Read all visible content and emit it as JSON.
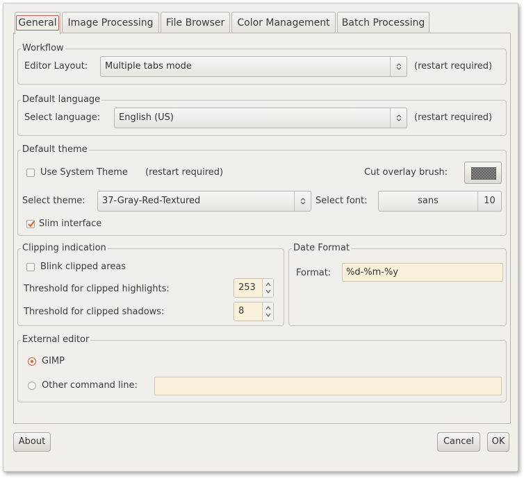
{
  "tabs": [
    {
      "label": "General",
      "active": true
    },
    {
      "label": "Image Processing"
    },
    {
      "label": "File Browser"
    },
    {
      "label": "Color Management"
    },
    {
      "label": "Batch Processing"
    }
  ],
  "workflow": {
    "title": "Workflow",
    "editor_layout_label": "Editor Layout:",
    "editor_layout_value": "Multiple tabs mode",
    "restart_note": "(restart required)"
  },
  "language": {
    "title": "Default language",
    "select_label": "Select language:",
    "select_value": "English (US)",
    "restart_note": "(restart required)"
  },
  "theme": {
    "title": "Default theme",
    "use_system_label": "Use System Theme",
    "use_system_checked": false,
    "use_system_note": "(restart required)",
    "cut_overlay_label": "Cut overlay brush:",
    "select_theme_label": "Select theme:",
    "select_theme_value": "37-Gray-Red-Textured",
    "select_font_label": "Select font:",
    "font_name": "sans",
    "font_size": "10",
    "slim_label": "Slim interface",
    "slim_checked": true
  },
  "clipping": {
    "title": "Clipping indication",
    "blink_label": "Blink clipped areas",
    "blink_checked": false,
    "highlights_label": "Threshold for clipped highlights:",
    "highlights_value": "253",
    "shadows_label": "Threshold for clipped shadows:",
    "shadows_value": "8"
  },
  "date_format": {
    "title": "Date Format",
    "format_label": "Format:",
    "format_value": "%d-%m-%y"
  },
  "external_editor": {
    "title": "External editor",
    "gimp_label": "GIMP",
    "gimp_selected": true,
    "other_label": "Other command line:",
    "other_value": ""
  },
  "buttons": {
    "about": "About",
    "cancel": "Cancel",
    "ok": "OK"
  },
  "colors": {
    "accent": "#e15f30",
    "entry_bg": "#f8f0d8",
    "dialog_bg": "#f1efeb"
  }
}
